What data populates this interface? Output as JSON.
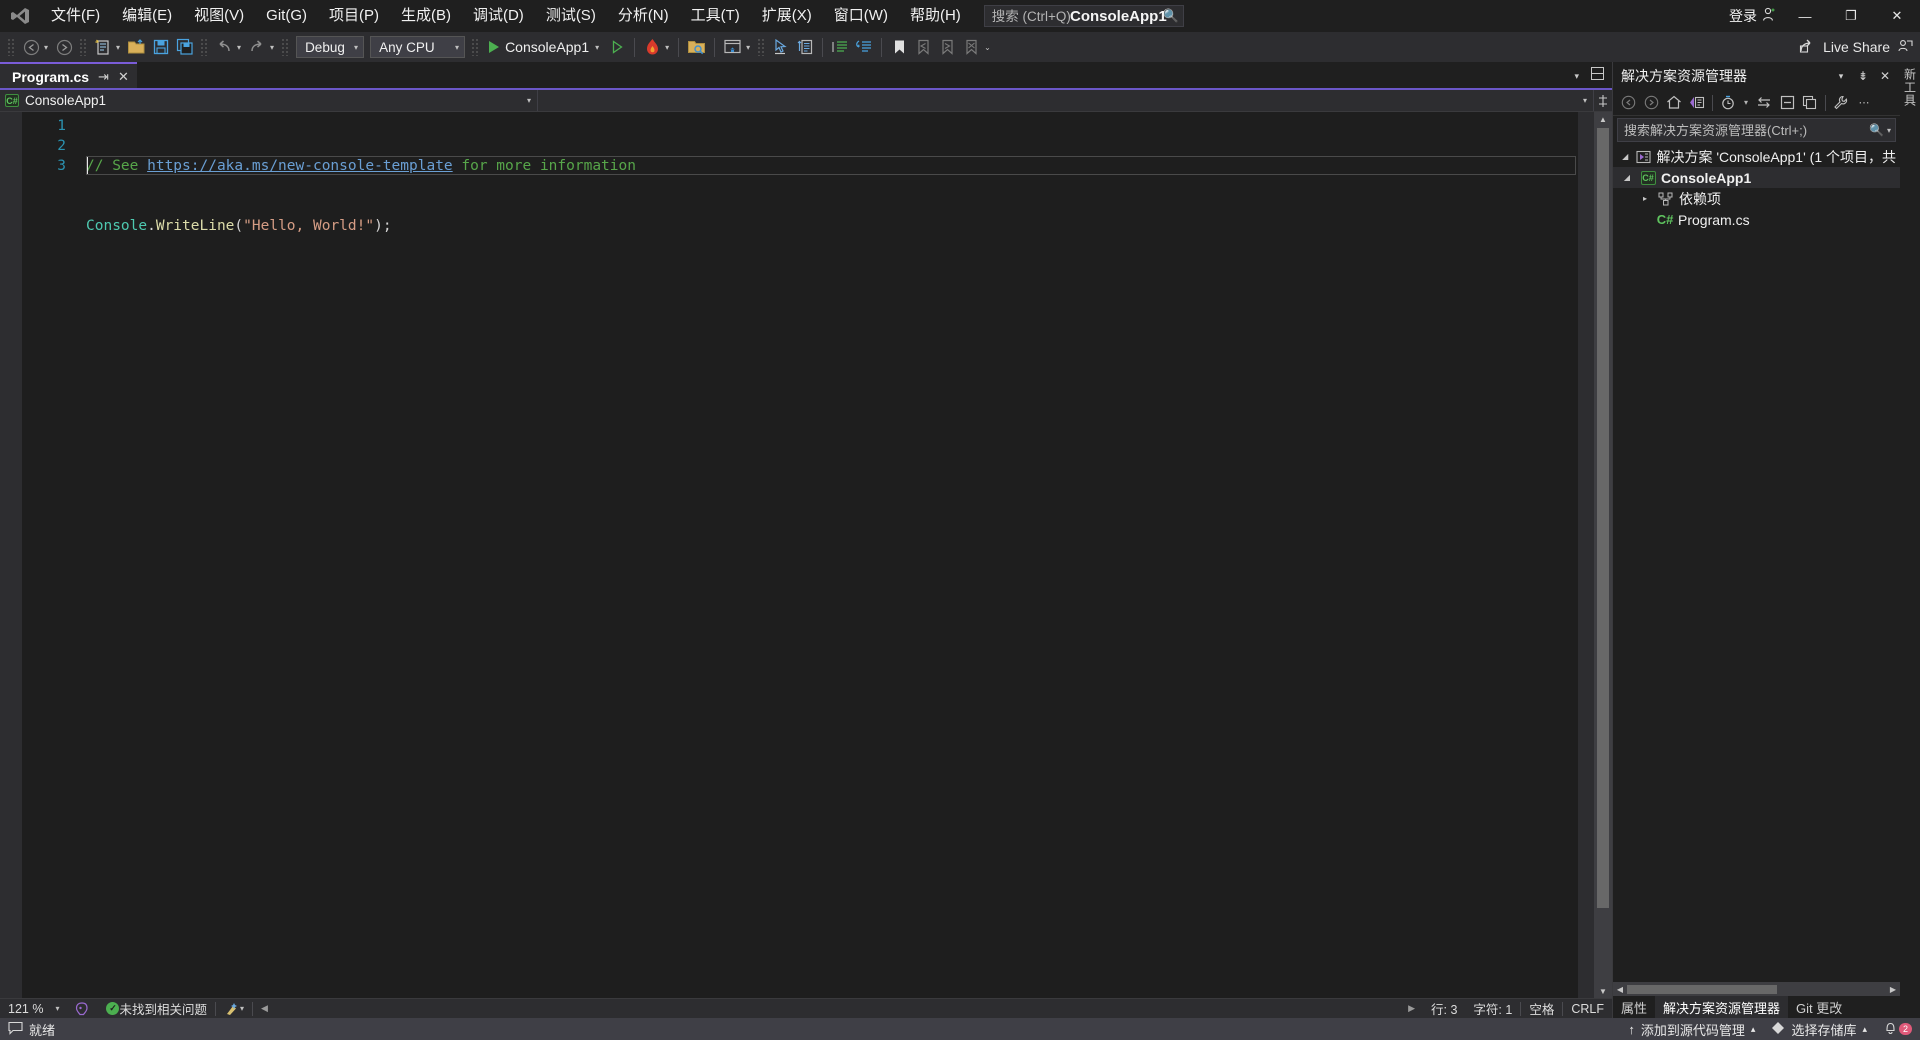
{
  "titlebar": {
    "menu_items": [
      {
        "label": "文件(F)",
        "name": "menu-file"
      },
      {
        "label": "编辑(E)",
        "name": "menu-edit"
      },
      {
        "label": "视图(V)",
        "name": "menu-view"
      },
      {
        "label": "Git(G)",
        "name": "menu-git"
      },
      {
        "label": "项目(P)",
        "name": "menu-project"
      },
      {
        "label": "生成(B)",
        "name": "menu-build"
      },
      {
        "label": "调试(D)",
        "name": "menu-debug"
      },
      {
        "label": "测试(S)",
        "name": "menu-test"
      },
      {
        "label": "分析(N)",
        "name": "menu-analyze"
      },
      {
        "label": "工具(T)",
        "name": "menu-tools"
      },
      {
        "label": "扩展(X)",
        "name": "menu-extensions"
      },
      {
        "label": "窗口(W)",
        "name": "menu-window"
      },
      {
        "label": "帮助(H)",
        "name": "menu-help"
      }
    ],
    "search_placeholder": "搜索 (Ctrl+Q)",
    "search_value": "",
    "app_title": "ConsoleApp1",
    "signin_label": "登录",
    "minimize": "—",
    "restore": "❐",
    "close": "✕"
  },
  "toolbar": {
    "nav_back": "back-arrow",
    "nav_forward": "forward-arrow",
    "configuration": "Debug",
    "platform": "Any CPU",
    "run_target": "ConsoleApp1",
    "live_share": "Live Share"
  },
  "editor": {
    "tab_label": "Program.cs",
    "tab_pin": "⇥",
    "tab_close": "✕",
    "nav_left": "ConsoleApp1",
    "nav_left_badge": "C#",
    "nav_right": "",
    "gutter": [
      "1",
      "2",
      "3"
    ],
    "code": {
      "line1_comment_prefix": "// See ",
      "line1_link": "https://aka.ms/new-console-template",
      "line1_comment_suffix": " for more information",
      "line2_class": "Console",
      "line2_dot": ".",
      "line2_method": "WriteLine",
      "line2_open": "(",
      "line2_string": "\"Hello, World!\"",
      "line2_close": ");",
      "line3": ""
    }
  },
  "editor_status": {
    "zoom": "121 %",
    "problems": "未找到相关问题",
    "line": "行: 3",
    "char": "字符: 1",
    "indent": "空格",
    "eol": "CRLF"
  },
  "solution_explorer": {
    "title": "解决方案资源管理器",
    "search_placeholder": "搜索解决方案资源管理器(Ctrl+;)",
    "search_value": "",
    "solution_node": "解决方案 'ConsoleApp1' (1 个项目，共",
    "project_node": "ConsoleApp1",
    "dependencies_node": "依赖项",
    "file_node": "Program.cs",
    "tabs": [
      {
        "label": "属性",
        "active": false
      },
      {
        "label": "解决方案资源管理器",
        "active": true
      },
      {
        "label": "Git 更改",
        "active": false
      }
    ],
    "dock_label": "新工具"
  },
  "statusbar": {
    "ready": "就绪",
    "add_to_source_control": "添加到源代码管理",
    "select_repository": "选择存储库",
    "notification_count": "2"
  },
  "colors": {
    "accent_purple": "#6b57c8",
    "window_bg": "#1f1f1f",
    "chrome_bg": "#2d2d30",
    "editor_bg": "#1e1e1e",
    "comment_green": "#57a64a",
    "link_blue": "#6a9fd4",
    "class_teal": "#4ec9b0",
    "method_yellow": "#dcdcaa",
    "string_orange": "#d69d85",
    "linenum_blue": "#2b91af",
    "status_blue": "#3f3f46"
  }
}
